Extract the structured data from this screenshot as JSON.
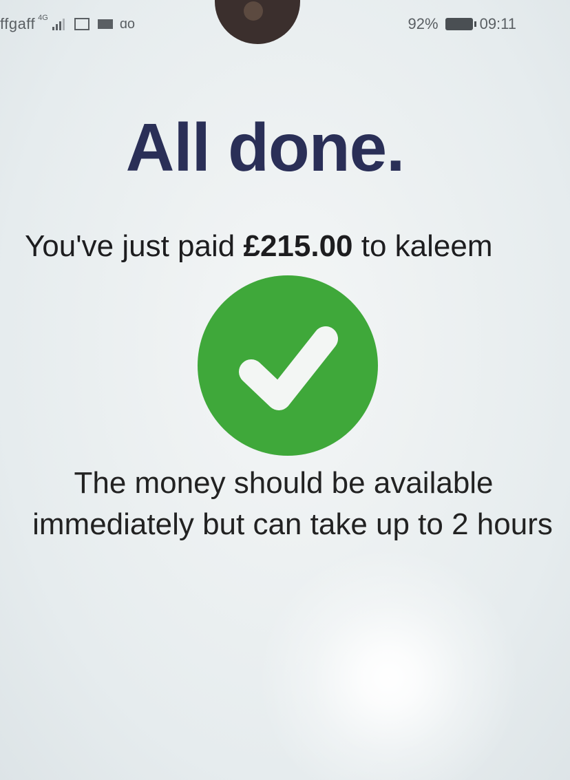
{
  "status_bar": {
    "carrier": "ffgaff",
    "network_type": "4G",
    "battery_percent": "92%",
    "time": "09:11",
    "icons": [
      "signal-icon",
      "image-icon",
      "mail-icon",
      "voicemail-icon",
      "battery-icon"
    ]
  },
  "confirmation": {
    "title": "All done.",
    "paid_prefix": "You've just paid",
    "amount": "£215.00",
    "paid_suffix": "to kaleem",
    "status_icon": "checkmark-icon",
    "info_line1": "The money should be available",
    "info_line2": "immediately but can take up to 2 hours"
  },
  "colors": {
    "title": "#2a2f57",
    "success_green": "#3fa83a",
    "background": "#e9eef0"
  }
}
